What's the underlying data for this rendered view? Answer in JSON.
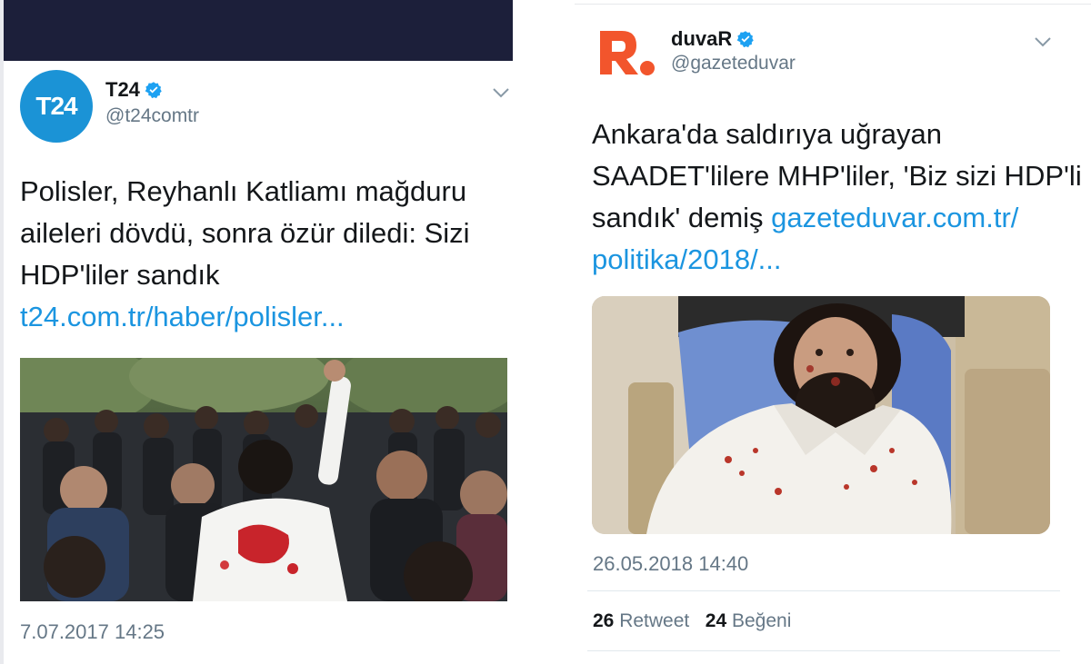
{
  "left_tweet": {
    "avatar_text": "T24",
    "account_name": "T24",
    "handle": "@t24comtr",
    "text": "Polisler, Reyhanlı Katliamı mağduru aileleri dövdü, sonra özür diledi: Sizi HDP'liler sandık",
    "line1": "Polisler, Reyhanlı Katliamı mağduru",
    "line2": "aileleri dövdü, sonra özür diledi: Sizi",
    "line3": "HDP'liler sandık",
    "link": "t24.com.tr/haber/polisler...",
    "timestamp": "7.07.2017 14:25"
  },
  "right_tweet": {
    "account_name": "duvaR",
    "handle": "@gazeteduvar",
    "line1": "Ankara'da saldırıya uğrayan",
    "line2": "SAADET'lilere MHP'liler, 'Biz sizi HDP'li",
    "line3_text": "sandık' demiş ",
    "line3_link": "gazeteduvar.com.tr/",
    "line4_link": "politika/2018/...",
    "timestamp": "26.05.2018 14:40",
    "retweet_count": "26",
    "retweet_label": "Retweet",
    "like_count": "24",
    "like_label": "Beğeni"
  },
  "colors": {
    "link": "#1b95e0",
    "avatar_t24": "#1b93d6",
    "logo_duvar": "#f2552c",
    "top_bar": "#1c1f3a",
    "verified": "#1da1f2"
  },
  "icons": [
    "verified-badge-icon",
    "chevron-down-icon"
  ]
}
